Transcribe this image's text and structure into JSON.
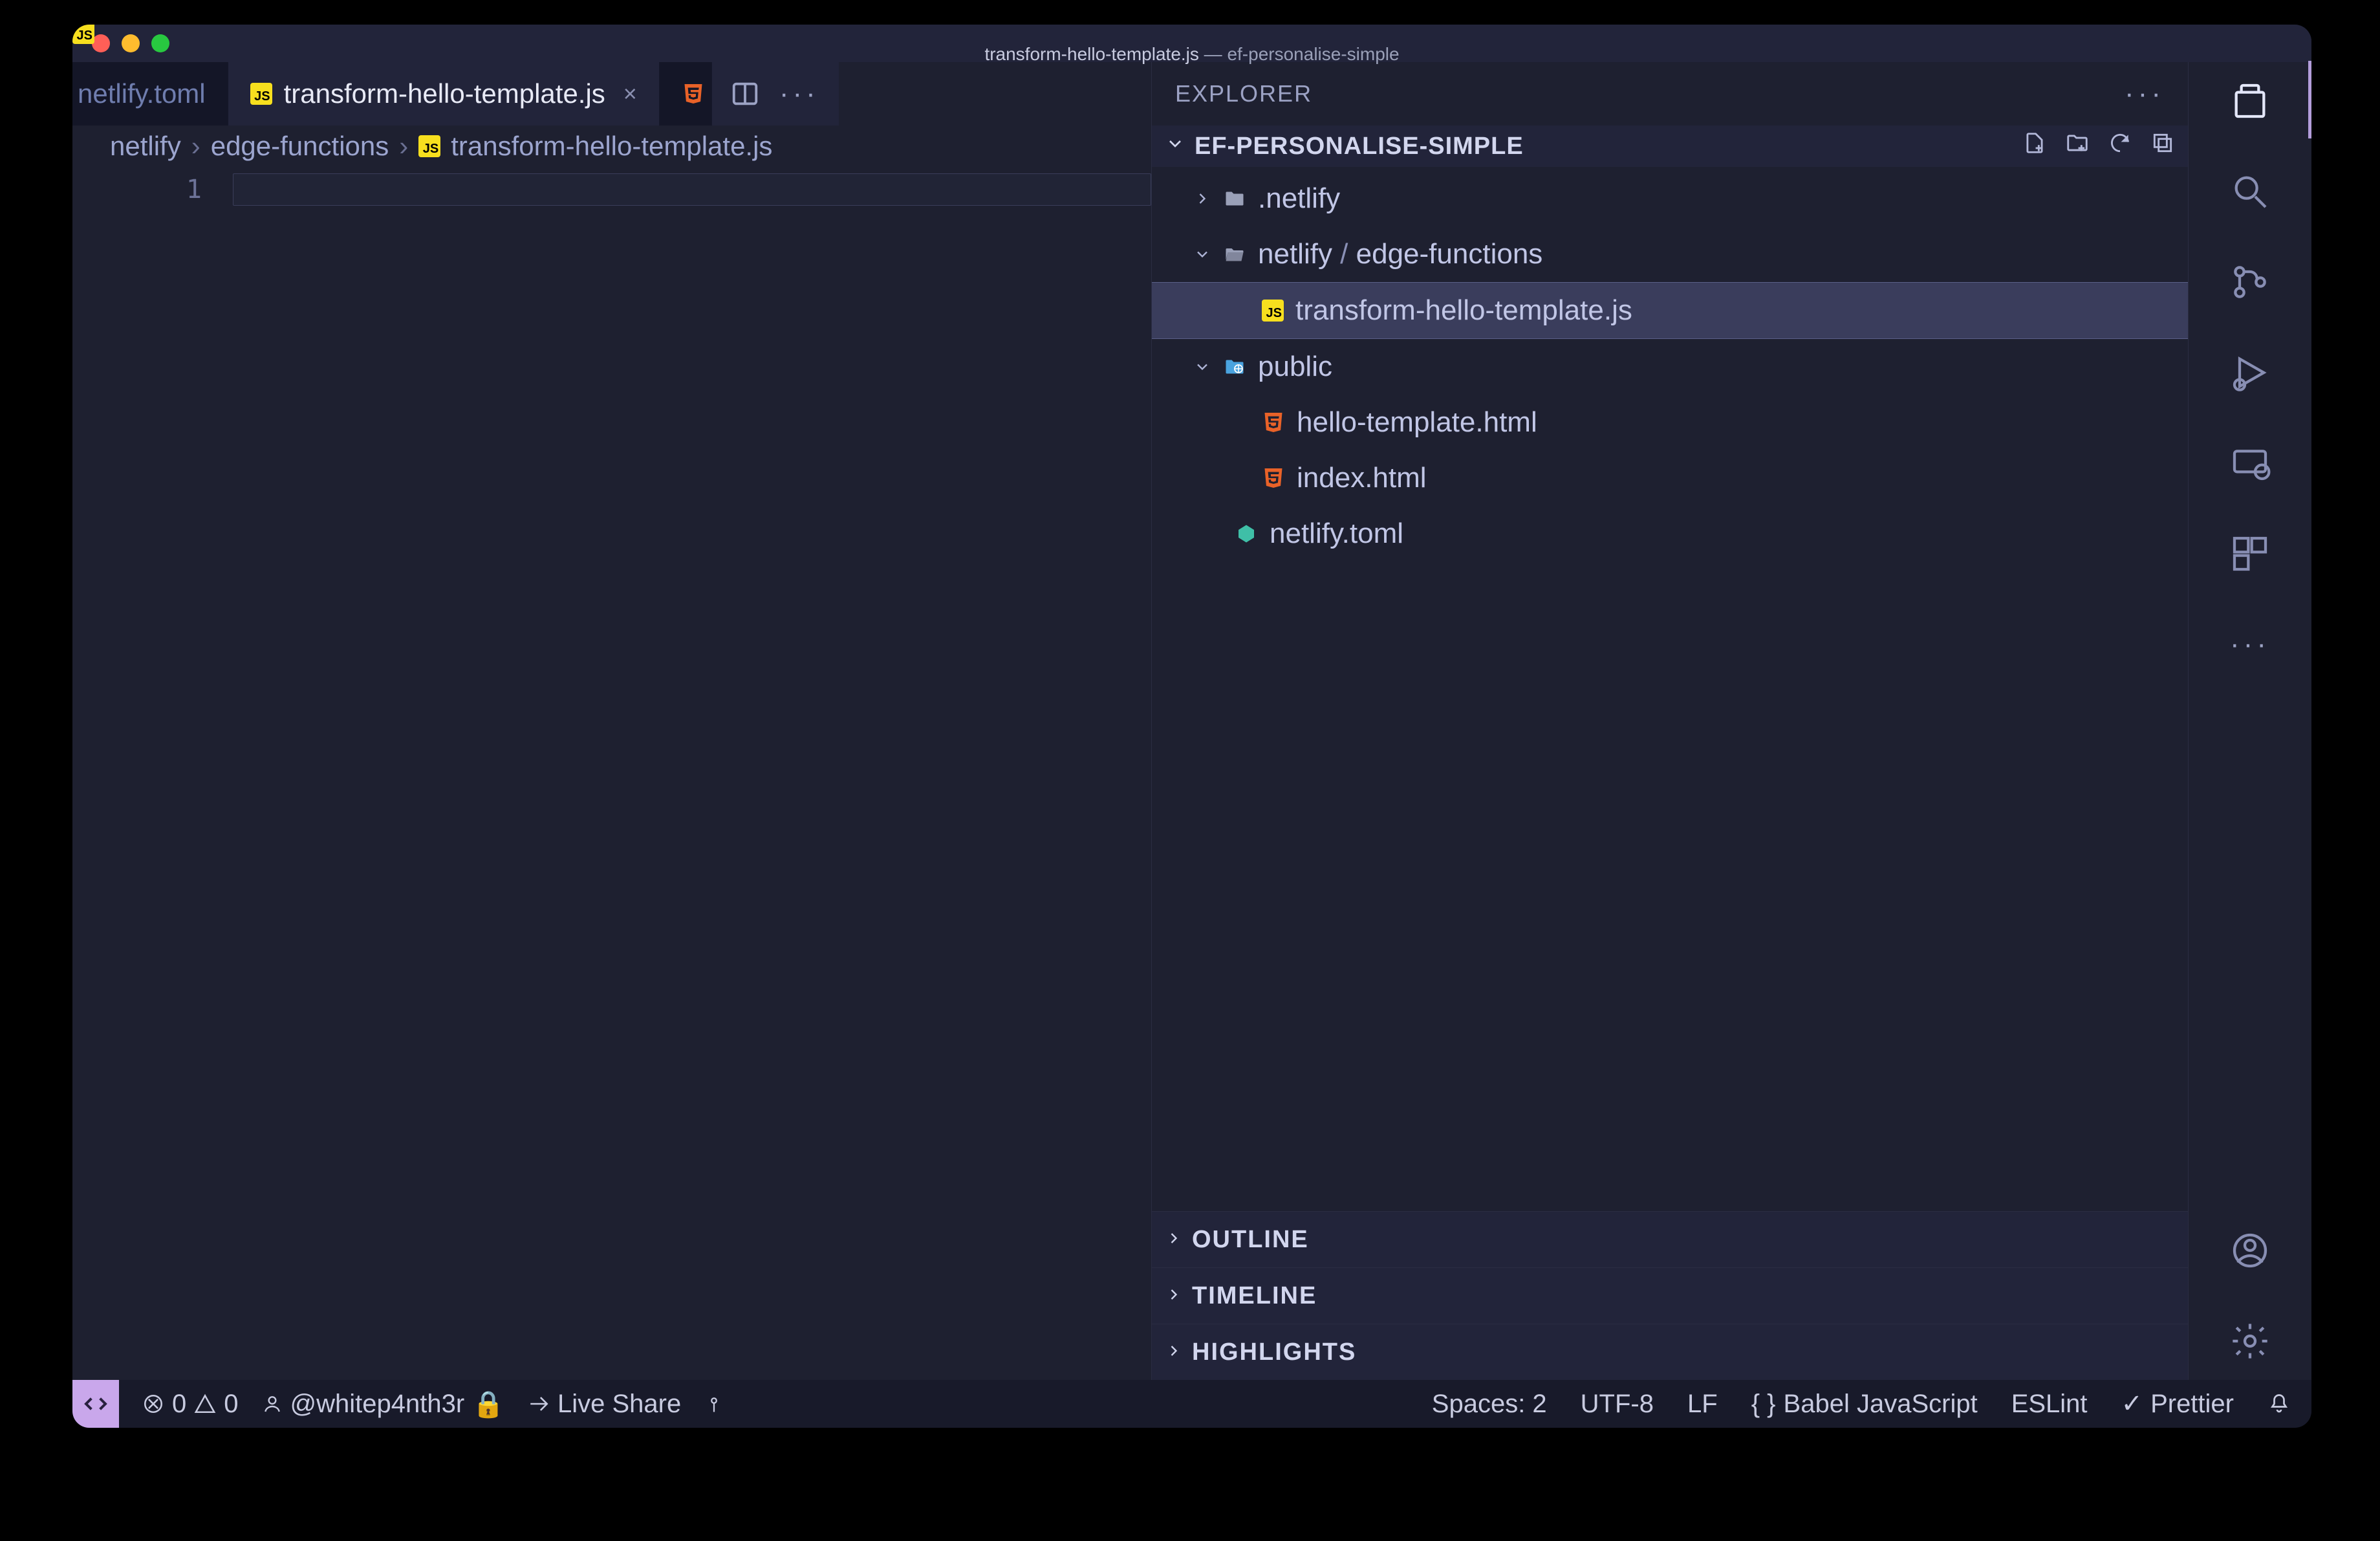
{
  "titlebar": {
    "filename": "transform-hello-template.js",
    "project": "ef-personalise-simple"
  },
  "tabs": {
    "partial": "netlify.toml",
    "active": "transform-hello-template.js"
  },
  "breadcrumbs": {
    "segments": [
      "netlify",
      "edge-functions",
      "transform-hello-template.js"
    ]
  },
  "editor": {
    "line_number": "1"
  },
  "panel": {
    "title": "EXPLORER",
    "section": "EF-PERSONALISE-SIMPLE",
    "collapsed": [
      "OUTLINE",
      "TIMELINE",
      "HIGHLIGHTS"
    ]
  },
  "tree": {
    "netlifyFolder": ".netlify",
    "netlifyPath": "netlify",
    "edgeFunctions": "edge-functions",
    "activeFile": "transform-hello-template.js",
    "publicFolder": "public",
    "helloTemplate": "hello-template.html",
    "indexHtml": "index.html",
    "tomlFile": "netlify.toml"
  },
  "status": {
    "errors": "0",
    "warnings": "0",
    "user": "@whitep4nth3r",
    "liveShare": "Live Share",
    "spaces": "Spaces: 2",
    "encoding": "UTF-8",
    "eol": "LF",
    "lang": "Babel JavaScript",
    "linter": "ESLint",
    "formatter": "Prettier"
  }
}
